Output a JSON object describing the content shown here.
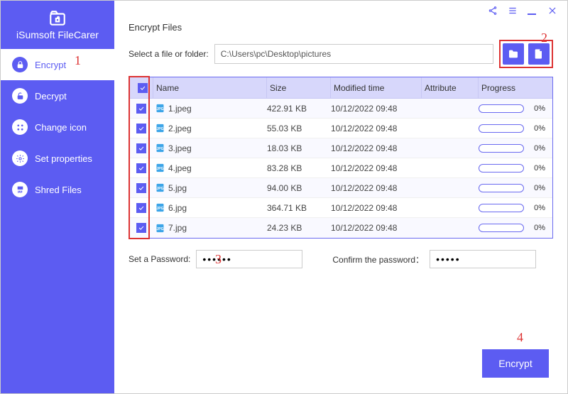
{
  "brand": {
    "name": "iSumsoft FileCarer"
  },
  "titlebar": {
    "share": "share",
    "menu": "menu",
    "min": "minimize",
    "close": "close"
  },
  "sidebar": {
    "items": [
      {
        "icon": "lock",
        "label": "Encrypt",
        "active": true
      },
      {
        "icon": "unlock",
        "label": "Decrypt",
        "active": false
      },
      {
        "icon": "grid",
        "label": "Change icon",
        "active": false
      },
      {
        "icon": "gear",
        "label": "Set properties",
        "active": false
      },
      {
        "icon": "shred",
        "label": "Shred Files",
        "active": false
      }
    ]
  },
  "section": {
    "title": "Encrypt Files"
  },
  "path": {
    "label": "Select a file or folder:",
    "value": "C:\\Users\\pc\\Desktop\\pictures",
    "browse_folder": "Browse folder",
    "browse_file": "Browse file"
  },
  "table": {
    "headers": {
      "name": "Name",
      "size": "Size",
      "time": "Modified time",
      "attr": "Attribute",
      "prog": "Progress"
    },
    "rows": [
      {
        "checked": true,
        "name": "1.jpeg",
        "size": "422.91 KB",
        "time": "10/12/2022 09:48",
        "attr": "",
        "progress": "0%"
      },
      {
        "checked": true,
        "name": "2.jpeg",
        "size": "55.03 KB",
        "time": "10/12/2022 09:48",
        "attr": "",
        "progress": "0%"
      },
      {
        "checked": true,
        "name": "3.jpeg",
        "size": "18.03 KB",
        "time": "10/12/2022 09:48",
        "attr": "",
        "progress": "0%"
      },
      {
        "checked": true,
        "name": "4.jpeg",
        "size": "83.28 KB",
        "time": "10/12/2022 09:48",
        "attr": "",
        "progress": "0%"
      },
      {
        "checked": true,
        "name": "5.jpg",
        "size": "94.00 KB",
        "time": "10/12/2022 09:48",
        "attr": "",
        "progress": "0%"
      },
      {
        "checked": true,
        "name": "6.jpg",
        "size": "364.71 KB",
        "time": "10/12/2022 09:48",
        "attr": "",
        "progress": "0%"
      },
      {
        "checked": true,
        "name": "7.jpg",
        "size": "24.23 KB",
        "time": "10/12/2022 09:48",
        "attr": "",
        "progress": "0%"
      }
    ]
  },
  "password": {
    "set_label": "Set a Password:",
    "set_value": "••••••",
    "confirm_label": "Confirm the password：",
    "confirm_value": "•••••"
  },
  "action": {
    "encrypt_label": "Encrypt"
  },
  "annotations": {
    "a1": "1",
    "a2": "2",
    "a3": "3",
    "a4": "4"
  }
}
